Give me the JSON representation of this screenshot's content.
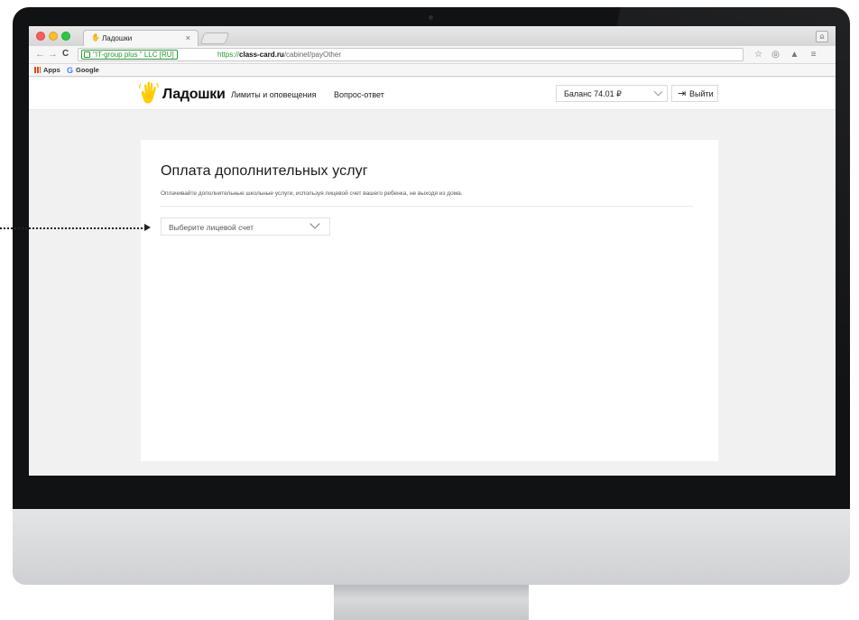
{
  "browser": {
    "tab_title": "Ладошки",
    "tab_close": "×",
    "ev_cert": "\"IT-group plus \" LLC [RU]",
    "url_scheme": "https://",
    "url_host": "class-card.ru",
    "url_path": "/cabinet/payOther",
    "bookmarks": [
      {
        "label": "Apps",
        "icon": "apps-grid-icon"
      },
      {
        "label": "Google",
        "icon": "google-g-icon"
      }
    ],
    "nav_icons": [
      "back-arrow-icon",
      "forward-arrow-icon",
      "reload-icon"
    ],
    "toolbar_icons": [
      "star-icon",
      "extension-icon",
      "drive-icon",
      "menu-icon"
    ]
  },
  "site": {
    "logo_text": "Ладошки",
    "logo_icon": "waving-hand-icon",
    "nav": [
      "Лимиты и оповещения",
      "Вопрос-ответ"
    ],
    "balance_label": "Баланс 74.01 ₽",
    "logout_label": "Выйти",
    "logout_icon": "sign-out-icon"
  },
  "main": {
    "title": "Оплата дополнительных услуг",
    "description": "Оплачивайте дополнительные школьные услуги, используя лицевой счет вашего ребенка, не выходя из дома.",
    "account_select_placeholder": "Выберите лицевой счет"
  },
  "colors": {
    "brand_yellow": "#ffcc00",
    "ev_green": "#239a30",
    "page_bg": "#f1f1f1"
  }
}
